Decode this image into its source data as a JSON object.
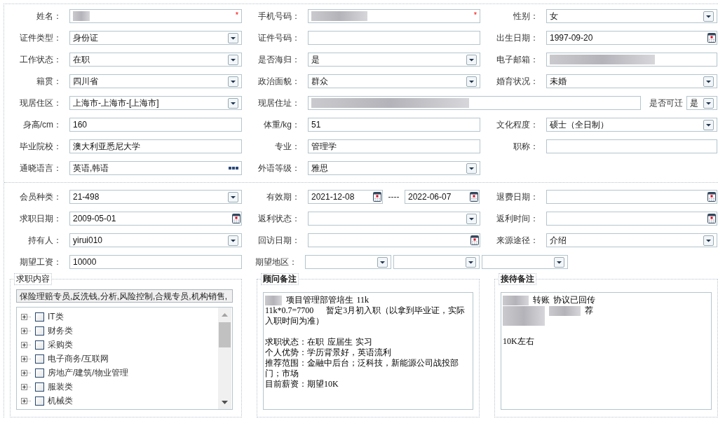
{
  "profile": {
    "rows": [
      {
        "kind": "standard",
        "fields": [
          {
            "label": "姓名：",
            "kind": "text",
            "mask": {
              "kind": "tinyblur"
            },
            "required_mark": "*"
          },
          {
            "label": "手机号码：",
            "kind": "text",
            "mask": {
              "kind": "widerblur"
            },
            "required_mark": "*"
          },
          {
            "label": "性别：",
            "kind": "select",
            "value": "女"
          }
        ]
      },
      {
        "kind": "standard",
        "fields": [
          {
            "label": "证件类型：",
            "kind": "select",
            "value": "身份证"
          },
          {
            "label": "证件号码：",
            "kind": "text"
          },
          {
            "label": "出生日期：",
            "kind": "date",
            "value": "1997-09-20"
          }
        ]
      },
      {
        "kind": "standard",
        "fields": [
          {
            "label": "工作状态：",
            "kind": "select",
            "value": "在职"
          },
          {
            "label": "是否海归：",
            "kind": "select",
            "value": "是"
          },
          {
            "label": "电子邮箱：",
            "kind": "text",
            "mask": {
              "kind": "hugeblur"
            }
          }
        ]
      },
      {
        "kind": "standard",
        "fields": [
          {
            "label": "籍贯：",
            "kind": "select",
            "value": "四川省"
          },
          {
            "label": "政治面貌：",
            "kind": "select",
            "value": "群众"
          },
          {
            "label": "婚育状况：",
            "kind": "select",
            "value": "未婚"
          }
        ]
      },
      {
        "kind": "address",
        "fields": [
          {
            "label": "现居住区：",
            "kind": "select",
            "value": "上海市-上海市-[上海市]"
          },
          {
            "label": "现居住址：",
            "kind": "text",
            "mask": {
              "kind": "giantblur"
            }
          },
          {
            "label": "是否可迁",
            "kind": "select",
            "value": "是"
          }
        ]
      },
      {
        "kind": "standard",
        "fields": [
          {
            "label": "身高/cm：",
            "kind": "text",
            "value": "160"
          },
          {
            "label": "体重/kg：",
            "kind": "text",
            "value": "51"
          },
          {
            "label": "文化程度：",
            "kind": "select",
            "value": "硕士（全日制）"
          }
        ]
      },
      {
        "kind": "standard",
        "fields": [
          {
            "label": "毕业院校：",
            "kind": "text",
            "value": "澳大利亚悉尼大学"
          },
          {
            "label": "专业：",
            "kind": "text",
            "value": "管理学"
          },
          {
            "label": "职称：",
            "kind": "text"
          }
        ]
      },
      {
        "kind": "standard",
        "fields": [
          {
            "label": "通晓语言：",
            "kind": "picker",
            "value": "英语,韩语"
          },
          {
            "label": "外语等级：",
            "kind": "select",
            "value": "雅思"
          }
        ]
      }
    ]
  },
  "membership": {
    "rows": [
      {
        "kind": "standard",
        "fields": [
          {
            "label": "会员种类：",
            "kind": "select",
            "value": "21-498"
          },
          {
            "label": "有效期：",
            "kind": "date_range",
            "start": "2021-12-08",
            "separator": "----",
            "end": "2022-06-07"
          },
          {
            "label": "退费日期：",
            "kind": "date"
          }
        ]
      },
      {
        "kind": "standard",
        "fields": [
          {
            "label": "求职日期：",
            "kind": "date",
            "value": "2009-05-01"
          },
          {
            "label": "返利状态：",
            "kind": "select"
          },
          {
            "label": "返利时间：",
            "kind": "date"
          }
        ]
      },
      {
        "kind": "standard",
        "fields": [
          {
            "label": "持有人：",
            "kind": "select",
            "value": "yirui010"
          },
          {
            "label": "回访日期：",
            "kind": "date"
          },
          {
            "label": "来源途径：",
            "kind": "select",
            "value": "介绍"
          }
        ]
      },
      {
        "kind": "standard",
        "fields": [
          {
            "label": "期望工资：",
            "kind": "text",
            "value": "10000"
          },
          {
            "label": "期望地区：",
            "kind": "select_group",
            "selects": [
              {
                "kind": "select"
              },
              {
                "kind": "select"
              },
              {
                "kind": "select"
              }
            ]
          }
        ]
      }
    ]
  },
  "job_intent": {
    "legend": "求职内容",
    "summary": "保险理赔专员,反洗钱,分析,风险控制,合规专员,机构销售,",
    "tree": [
      {
        "label": "IT类",
        "expanded": false,
        "checked": false
      },
      {
        "label": "财务类",
        "expanded": false,
        "checked": false
      },
      {
        "label": "采购类",
        "expanded": false,
        "checked": false
      },
      {
        "label": "电子商务/互联网",
        "expanded": false,
        "checked": false
      },
      {
        "label": "房地产/建筑/物业管理",
        "expanded": false,
        "checked": false
      },
      {
        "label": "服装类",
        "expanded": false,
        "checked": false
      },
      {
        "label": "机械类",
        "expanded": false,
        "checked": false
      }
    ]
  },
  "consultant_notes": {
    "legend": "顾问备注",
    "lines": [
      {
        "segments": [
          {
            "kind": "tinyblur"
          },
          {
            "kind": "text",
            "text": "项目管理部管培生 11k"
          }
        ]
      },
      {
        "segments": [
          {
            "kind": "text",
            "text": "11k*0.7=7700    暂定3月初入职（以拿到毕业证，实际入职时间为准）"
          }
        ]
      },
      {
        "segments": [
          {
            "kind": "blank"
          }
        ]
      },
      {
        "segments": [
          {
            "kind": "text",
            "text": "求职状态：在职 应届生 实习"
          }
        ]
      },
      {
        "segments": [
          {
            "kind": "text",
            "text": "个人优势：学历背景好，英语流利"
          }
        ]
      },
      {
        "segments": [
          {
            "kind": "text",
            "text": "推荐范围：金融中后台；泛科技，新能源公司战投部门；市场"
          }
        ]
      },
      {
        "segments": [
          {
            "kind": "text",
            "text": "目前薪资：期望10K"
          }
        ]
      }
    ]
  },
  "reception_notes": {
    "legend": "接待备注",
    "lines": [
      {
        "segments": [
          {
            "kind": "shortblur"
          },
          {
            "kind": "text",
            "text": "转账 协议已回传"
          }
        ]
      },
      {
        "segments": [
          {
            "kind": "longblur"
          },
          {
            "kind": "midblur"
          },
          {
            "kind": "text",
            "text": "荐"
          }
        ]
      },
      {
        "segments": [
          {
            "kind": "longblur"
          }
        ]
      },
      {
        "segments": [
          {
            "kind": "blank"
          }
        ]
      },
      {
        "segments": [
          {
            "kind": "text",
            "text": "10K左右"
          }
        ]
      }
    ]
  }
}
